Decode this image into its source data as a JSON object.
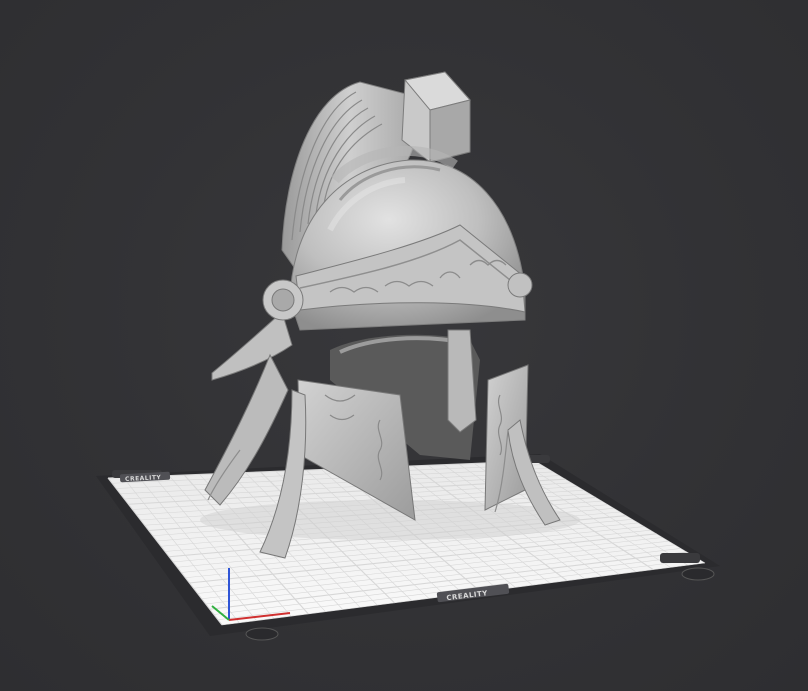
{
  "viewport": {
    "background_color": "#323235",
    "bed": {
      "brand_label_front": "CREALITY",
      "brand_label_back": "CREALITY",
      "grid_color": "#d7d7d7",
      "surface_color": "#f2f2f2",
      "frame_color": "#2a2a2d"
    },
    "model": {
      "name": "helmet",
      "color": "#bdbdbd"
    },
    "axes": {
      "x_color": "#d03030",
      "y_color": "#30b040",
      "z_color": "#2f55d6"
    }
  }
}
